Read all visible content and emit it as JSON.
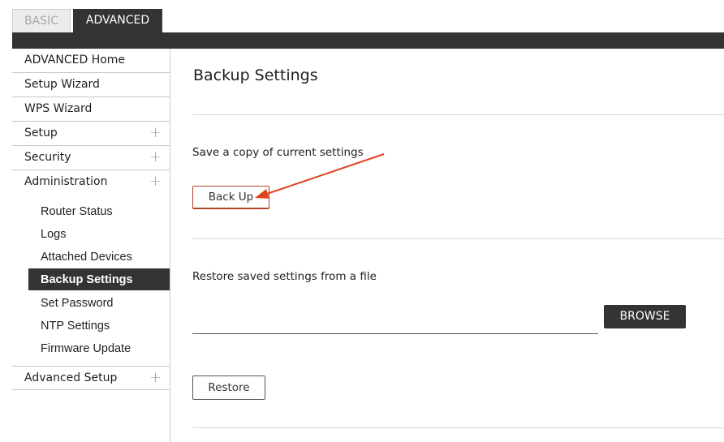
{
  "tabs": {
    "basic": "BASIC",
    "advanced": "ADVANCED"
  },
  "sidebar": {
    "items": [
      {
        "label": "ADVANCED Home"
      },
      {
        "label": "Setup Wizard"
      },
      {
        "label": "WPS Wizard"
      },
      {
        "label": "Setup",
        "expand_icon": "plus-icon"
      },
      {
        "label": "Security",
        "expand_icon": "plus-icon"
      },
      {
        "label": "Administration",
        "expand_icon": "plus-icon"
      }
    ],
    "sub_items": [
      {
        "label": "Router Status"
      },
      {
        "label": "Logs"
      },
      {
        "label": "Attached Devices"
      },
      {
        "label": "Backup Settings",
        "active": true
      },
      {
        "label": "Set Password"
      },
      {
        "label": "NTP Settings"
      },
      {
        "label": "Firmware Update"
      }
    ],
    "bottom_item": {
      "label": "Advanced Setup",
      "expand_icon": "plus-icon"
    }
  },
  "main": {
    "title": "Backup Settings",
    "backup": {
      "label": "Save a copy of current settings",
      "button": "Back Up"
    },
    "restore": {
      "label": "Restore saved settings from a file",
      "browse_button": "BROWSE",
      "restore_button": "Restore"
    }
  },
  "colors": {
    "dark": "#333333",
    "annotation_arrow": "#e0451f"
  }
}
